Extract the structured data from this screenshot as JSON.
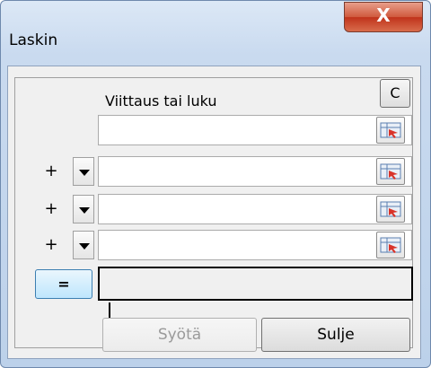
{
  "window": {
    "title": "Laskin",
    "close_glyph": "X"
  },
  "header": {
    "label": "Viittaus tai luku",
    "clear_label": "C"
  },
  "rows": [
    {
      "operator": "+",
      "value": ""
    },
    {
      "operator": "+",
      "value": ""
    },
    {
      "operator": "+",
      "value": ""
    }
  ],
  "equals_label": "=",
  "result_value": "",
  "buttons": {
    "insert_label": "Syötä",
    "close_label": "Sulje"
  },
  "colors": {
    "accent": "#3c7fb1",
    "close": "#c0331b"
  }
}
